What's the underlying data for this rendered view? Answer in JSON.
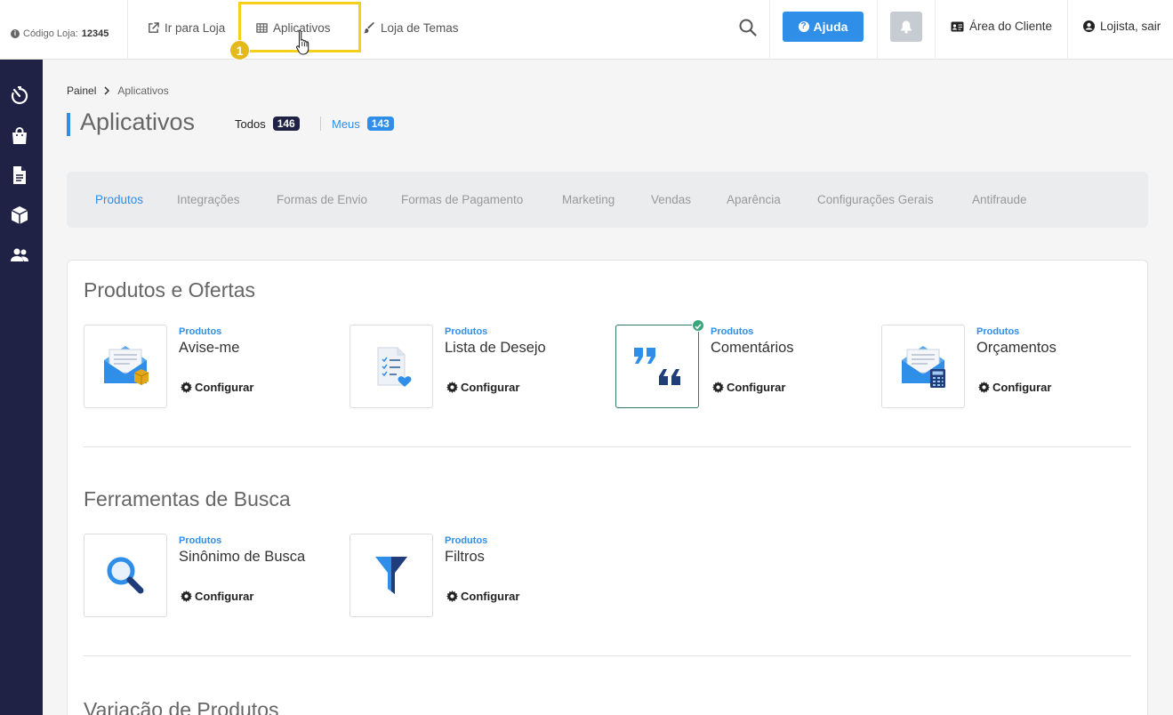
{
  "topbar": {
    "store_code_label": "Código Loja:",
    "store_code_value": "12345",
    "nav": [
      {
        "label": "Ir para Loja",
        "icon": "external-link-icon"
      },
      {
        "label": "Aplicativos",
        "icon": "grid-icon"
      },
      {
        "label": "Loja de Temas",
        "icon": "brush-icon"
      }
    ],
    "step_number": "1",
    "help_label": "Ajuda",
    "client_area_label": "Área do Cliente",
    "logout_label": "Lojista, sair",
    "highlight_color": "#f4cf1c",
    "accent": "#2f8ee8"
  },
  "sidebar": {
    "icons": [
      "stopwatch-icon",
      "shopping-bag-icon",
      "document-icon",
      "box-icon",
      "users-icon"
    ],
    "background": "#1f2145"
  },
  "breadcrumb": {
    "home": "Painel",
    "current": "Aplicativos"
  },
  "page": {
    "title": "Aplicativos",
    "filter_all_label": "Todos",
    "filter_all_count": "146",
    "filter_mine_label": "Meus",
    "filter_mine_count": "143"
  },
  "categories": [
    "Produtos",
    "Integrações",
    "Formas de Envio",
    "Formas de Pagamento",
    "Marketing",
    "Vendas",
    "Aparência",
    "Configurações Gerais",
    "Antifraude"
  ],
  "sections": [
    {
      "title": "Produtos e Ofertas",
      "apps": [
        {
          "category": "Produtos",
          "name": "Avise-me",
          "action": "Configurar",
          "icon": "envelope-box-icon",
          "installed": false
        },
        {
          "category": "Produtos",
          "name": "Lista de Desejo",
          "action": "Configurar",
          "icon": "wishlist-icon",
          "installed": false
        },
        {
          "category": "Produtos",
          "name": "Comentários",
          "action": "Configurar",
          "icon": "quotes-icon",
          "installed": true
        },
        {
          "category": "Produtos",
          "name": "Orçamentos",
          "action": "Configurar",
          "icon": "envelope-calculator-icon",
          "installed": false
        }
      ]
    },
    {
      "title": "Ferramentas de Busca",
      "apps": [
        {
          "category": "Produtos",
          "name": "Sinônimo de Busca",
          "action": "Configurar",
          "icon": "magnifier-icon",
          "installed": false
        },
        {
          "category": "Produtos",
          "name": "Filtros",
          "action": "Configurar",
          "icon": "funnel-icon",
          "installed": false
        }
      ]
    },
    {
      "title": "Variação de Produtos"
    }
  ]
}
